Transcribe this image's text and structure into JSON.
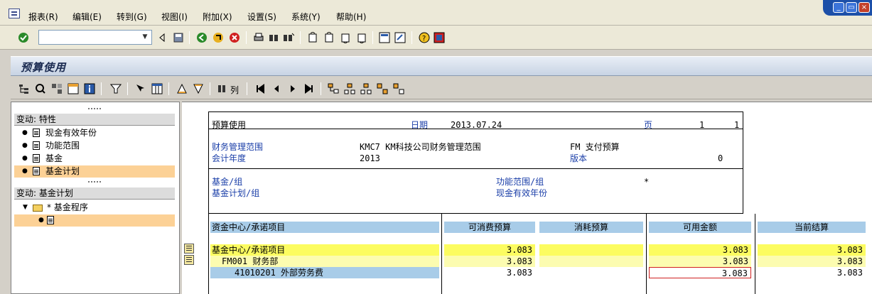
{
  "menu": {
    "items": [
      "报表(R)",
      "编辑(E)",
      "转到(G)",
      "视图(I)",
      "附加(X)",
      "设置(S)",
      "系统(Y)",
      "帮助(H)"
    ]
  },
  "window_buttons": {
    "minimize": "_",
    "restore": "▭",
    "close": "×"
  },
  "title": "预算使用",
  "left_panel": {
    "group1_header": "变动: 特性",
    "group1_items": [
      "现金有效年份",
      "功能范围",
      "基金",
      "基金计划"
    ],
    "group2_header": "变动: 基金计划",
    "group2_folder": "* 基金程序"
  },
  "app_toolbar": {
    "columns_label": "列"
  },
  "report": {
    "title": "预算使用",
    "date_label": "日期",
    "date_value": "2013.07.24",
    "page_label": "页",
    "page_value": "1",
    "page_total": "1",
    "fm_area_label": "财务管理范围",
    "fm_area_value": "KMC7 KM科技公司财务管理范围",
    "fiscal_year_label": "会计年度",
    "fiscal_year_value": "2013",
    "fm_label": "FM 支付预算",
    "version_label": "版本",
    "version_value": "0",
    "fund_group_label": "基金/组",
    "func_area_group_label": "功能范围/组",
    "func_area_group_value": "*",
    "fund_plan_group_label": "基金计划/组",
    "cash_year_label": "现金有效年份",
    "columns": [
      "资金中心/承诺项目",
      "可消费预算",
      "消耗预算",
      "可用金额",
      "当前结算"
    ],
    "rows": [
      {
        "name": "基金中心/承诺项目",
        "consumable": "3.083",
        "consumed": "",
        "available": "3.083",
        "current": "3.083"
      },
      {
        "name": "FM001  财务部",
        "consumable": "3.083",
        "consumed": "",
        "available": "3.083",
        "current": "3.083"
      },
      {
        "name": "41010201  外部劳务费",
        "consumable": "3.083",
        "consumed": "",
        "available": "3.083",
        "current": "3.083"
      }
    ]
  }
}
